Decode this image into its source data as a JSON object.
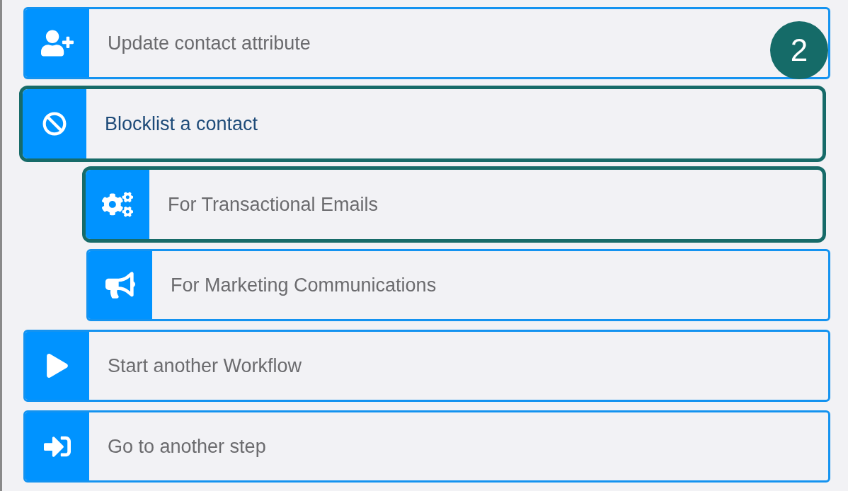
{
  "actions": [
    {
      "label": "Update contact attribute",
      "kind": "user-plus",
      "highlighted": false,
      "expanded": false
    },
    {
      "label": "Blocklist a contact",
      "kind": "ban",
      "highlighted": true,
      "expanded": true,
      "children": [
        {
          "label": "For Transactional Emails",
          "kind": "gears",
          "highlighted": true,
          "expanded": false
        },
        {
          "label": "For Marketing Communications",
          "kind": "megaphone",
          "highlighted": false,
          "expanded": false
        }
      ]
    },
    {
      "label": "Start another Workflow",
      "kind": "play",
      "highlighted": false,
      "expanded": false
    },
    {
      "label": "Go to another step",
      "kind": "enter",
      "highlighted": false,
      "expanded": false
    }
  ],
  "step_badge": "2"
}
